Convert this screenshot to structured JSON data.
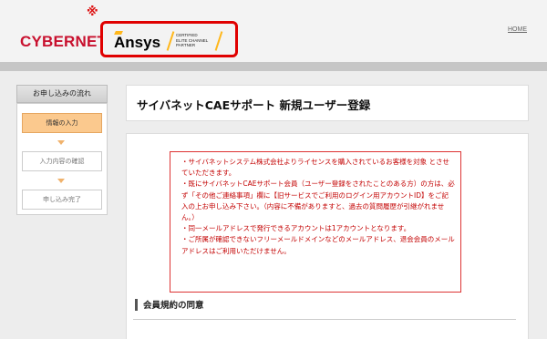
{
  "header": {
    "logo": "CYBERNET",
    "kome": "※",
    "partner_brand": "Ansys",
    "partner_badge": [
      "CERTIFIED",
      "ELITE CHANNEL",
      "PARTNER"
    ],
    "home_link": "HOME"
  },
  "sidebar": {
    "title": "お申し込みの流れ",
    "steps": [
      "情報の入力",
      "入力内容の確認",
      "申し込み完了"
    ]
  },
  "main": {
    "title": "サイバネットCAEサポート 新規ユーザー登録",
    "notice": [
      "・サイバネットシステム株式会社よりライセンスを購入されているお客様を対象 とさせていただきます。",
      "・既にサイバネットCAEサポート会員（ユーザー登録をされたことのある方）の方は、必ず「その他ご連絡事項」欄に【旧サービスでご利用のログイン用アカウントID】をご記入の上お申し込み下さい。（内容に不備がありますと、過去の質問履歴が引継がれません。）",
      "・同一メールアドレスで発行できるアカウントは1アカウントとなります。",
      "・ご所属が確認できないフリーメールドメインなどのメールアドレス、退会会員のメールアドレスはご利用いただけません。"
    ],
    "section_title": "会員規約の同意"
  },
  "colors": {
    "brand_red": "#c8102e",
    "highlight_border": "#e00000",
    "ansys_accent": "#ffb71b",
    "notice_red": "#c30000",
    "active_step": "#fbc98e"
  }
}
